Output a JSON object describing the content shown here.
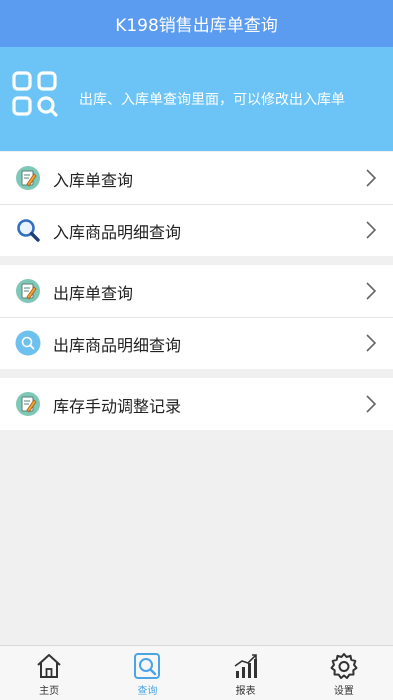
{
  "header": {
    "title": "K198销售出库单查询"
  },
  "banner": {
    "icon": "grid-search-icon",
    "text": "出库、入库单查询里面，可以修改出入库单"
  },
  "menu": {
    "groups": [
      {
        "items": [
          {
            "label": "入库单查询",
            "icon": "edit-note-icon"
          },
          {
            "label": "入库商品明细查询",
            "icon": "magnifier-icon"
          }
        ]
      },
      {
        "items": [
          {
            "label": "出库单查询",
            "icon": "edit-note-icon"
          },
          {
            "label": "出库商品明细查询",
            "icon": "search-circle-icon"
          }
        ]
      },
      {
        "items": [
          {
            "label": "库存手动调整记录",
            "icon": "edit-note-icon"
          }
        ]
      }
    ]
  },
  "tabbar": {
    "active": "查询",
    "tabs": [
      {
        "label": "主页",
        "icon": "home-icon"
      },
      {
        "label": "查询",
        "icon": "search-box-icon"
      },
      {
        "label": "报表",
        "icon": "chart-icon"
      },
      {
        "label": "设置",
        "icon": "gear-icon"
      }
    ]
  },
  "colors": {
    "titlebar": "#5b9cf0",
    "banner": "#6cc4f6",
    "active_tab": "#4aa4e6",
    "background": "#f0f0f0"
  }
}
